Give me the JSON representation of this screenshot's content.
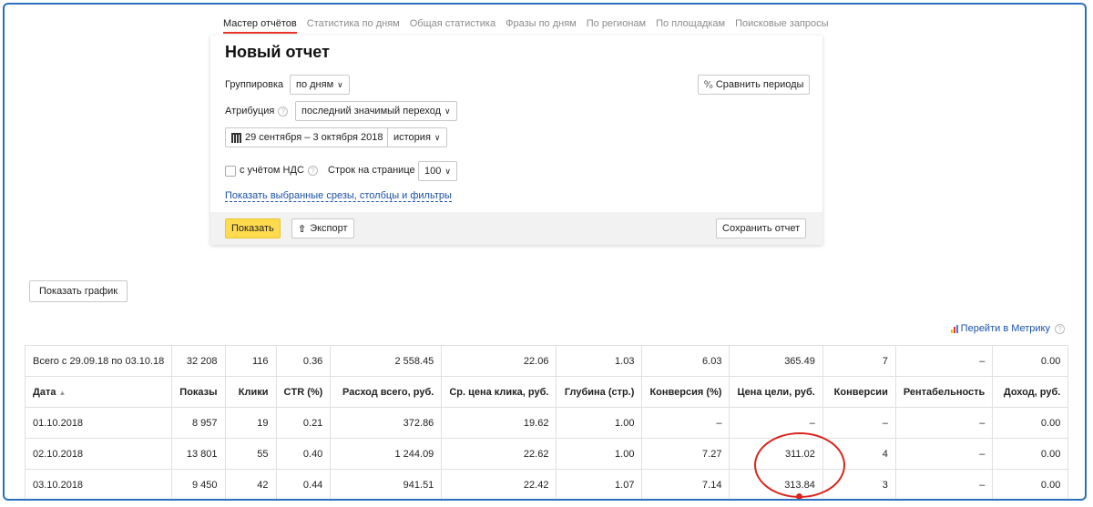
{
  "tabs": [
    {
      "label": "Мастер отчётов",
      "active": true
    },
    {
      "label": "Статистика по дням",
      "active": false
    },
    {
      "label": "Общая статистика",
      "active": false
    },
    {
      "label": "Фразы по дням",
      "active": false
    },
    {
      "label": "По регионам",
      "active": false
    },
    {
      "label": "По площадкам",
      "active": false
    },
    {
      "label": "Поисковые запросы",
      "active": false
    }
  ],
  "card": {
    "title": "Новый отчет",
    "grouping_label": "Группировка",
    "grouping_value": "по дням",
    "compare_button": "Сравнить периоды",
    "attribution_label": "Атрибуция",
    "attribution_value": "последний значимый переход",
    "date_range": "29 сентября – 3 октября 2018",
    "history_button": "история",
    "vat_label": "с учётом НДС",
    "rows_per_page_label": "Строк на странице",
    "rows_per_page_value": "100",
    "show_filters_link": "Показать выбранные срезы, столбцы и фильтры",
    "show_button": "Показать",
    "export_button": "Экспорт",
    "save_button": "Сохранить отчет"
  },
  "show_chart_button": "Показать график",
  "metrika_link": "Перейти в Метрику",
  "colors": {
    "accent_yellow": "#ffdb4d",
    "active_tab_underline": "#e8342a",
    "link_blue": "#1a50a8",
    "annotation_red": "#d9261c"
  },
  "table": {
    "totals": [
      "Всего с 29.09.18 по 03.10.18",
      "32 208",
      "116",
      "0.36",
      "2 558.45",
      "22.06",
      "1.03",
      "6.03",
      "365.49",
      "7",
      "–",
      "0.00"
    ],
    "headers": [
      "Дата",
      "Показы",
      "Клики",
      "CTR (%)",
      "Расход всего, руб.",
      "Ср. цена клика, руб.",
      "Глубина (стр.)",
      "Конверсия (%)",
      "Цена цели, руб.",
      "Конверсии",
      "Рентабельность",
      "Доход, руб."
    ],
    "sort_indicator": "▲",
    "rows": [
      [
        "01.10.2018",
        "8 957",
        "19",
        "0.21",
        "372.86",
        "19.62",
        "1.00",
        "–",
        "–",
        "–",
        "–",
        "0.00"
      ],
      [
        "02.10.2018",
        "13 801",
        "55",
        "0.40",
        "1 244.09",
        "22.62",
        "1.00",
        "7.27",
        "311.02",
        "4",
        "–",
        "0.00"
      ],
      [
        "03.10.2018",
        "9 450",
        "42",
        "0.44",
        "941.51",
        "22.42",
        "1.07",
        "7.14",
        "313.84",
        "3",
        "–",
        "0.00"
      ]
    ]
  }
}
